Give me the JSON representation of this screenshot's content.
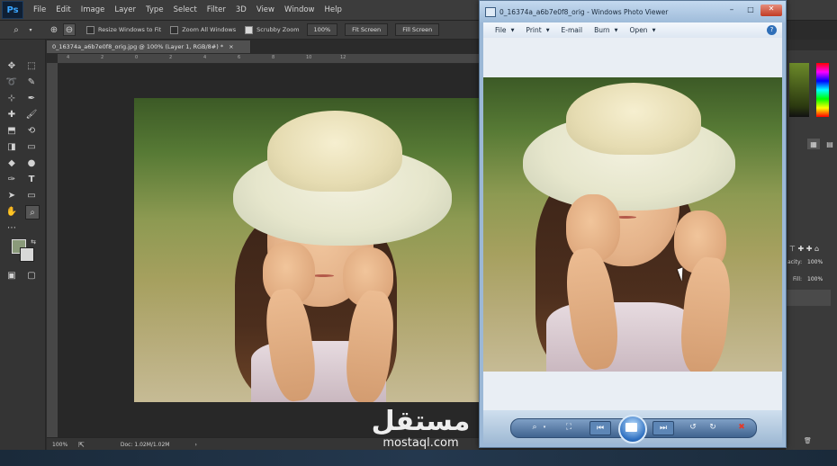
{
  "photoshop": {
    "logo": "Ps",
    "menus": [
      "File",
      "Edit",
      "Image",
      "Layer",
      "Type",
      "Select",
      "Filter",
      "3D",
      "View",
      "Window",
      "Help"
    ],
    "options": {
      "checks": [
        {
          "label": "Resize Windows to Fit",
          "checked": false
        },
        {
          "label": "Zoom All Windows",
          "checked": false
        },
        {
          "label": "Scrubby Zoom",
          "checked": true
        }
      ],
      "buttons": [
        "100%",
        "Fit Screen",
        "Fill Screen"
      ]
    },
    "document_tab": "0_16374a_a6b7e0f8_orig.jpg @ 100% (Layer 1, RGB/8#) *",
    "document_close": "×",
    "ruler_ticks": [
      "4",
      "2",
      "0",
      "2",
      "4",
      "6",
      "8",
      "10",
      "12"
    ],
    "status": {
      "zoom": "100%",
      "doc": "Doc: 1.02M/1.02M",
      "arrow": "›"
    },
    "panels": {
      "opacity_label": "acity:",
      "opacity_value": "100%",
      "fill_label": "Fill:",
      "fill_value": "100%"
    }
  },
  "photo_viewer": {
    "title": "0_16374a_a6b7e0f8_orig - Windows Photo Viewer",
    "menus": [
      "File",
      "Print",
      "E-mail",
      "Burn",
      "Open"
    ],
    "menu_has_caret": [
      true,
      true,
      false,
      true,
      true
    ],
    "help_icon": "?"
  },
  "watermark": {
    "arabic": "مستقل",
    "latin": "mostaql.com"
  },
  "colors": {
    "ps_accent": "#3aa6ff",
    "pv_title": "#1b2b3d",
    "watermark": "#ffffff"
  }
}
